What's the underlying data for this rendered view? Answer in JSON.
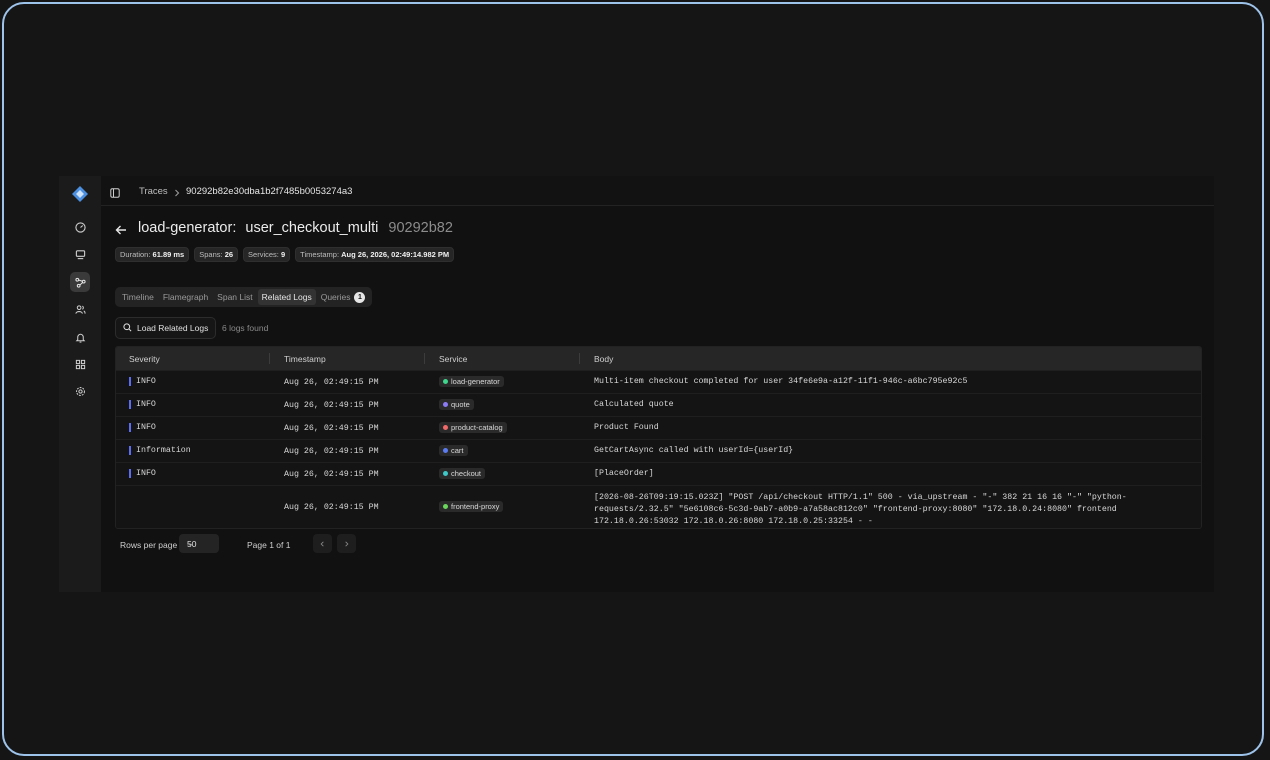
{
  "breadcrumb": {
    "section": "Traces",
    "trace_id": "90292b82e30dba1b2f7485b0053274a3"
  },
  "header": {
    "service": "load-generator:",
    "operation": "user_checkout_multi",
    "short_id": "90292b82"
  },
  "badges": [
    {
      "label": "Duration:",
      "value": "61.89 ms"
    },
    {
      "label": "Spans:",
      "value": "26"
    },
    {
      "label": "Services:",
      "value": "9"
    },
    {
      "label": "Timestamp:",
      "value": "Aug 26, 2026, 02:49:14.982 PM"
    }
  ],
  "tabs": [
    {
      "label": "Timeline",
      "active": false
    },
    {
      "label": "Flamegraph",
      "active": false
    },
    {
      "label": "Span List",
      "active": false
    },
    {
      "label": "Related Logs",
      "active": true
    },
    {
      "label": "Queries",
      "active": false,
      "count": "1"
    }
  ],
  "actions": {
    "load_label": "Load Related Logs",
    "log_count": "6 logs found"
  },
  "table": {
    "columns": [
      "Severity",
      "Timestamp",
      "Service",
      "Body"
    ],
    "rows": [
      {
        "severity": "INFO",
        "timestamp": "Aug 26, 02:49:15 PM",
        "service": "load-generator",
        "service_color": "#3dd68c",
        "body": "Multi-item checkout completed for user 34fe6e9a-a12f-11f1-946c-a6bc795e92c5"
      },
      {
        "severity": "INFO",
        "timestamp": "Aug 26, 02:49:15 PM",
        "service": "quote",
        "service_color": "#8b7cf6",
        "body": "Calculated quote"
      },
      {
        "severity": "INFO",
        "timestamp": "Aug 26, 02:49:15 PM",
        "service": "product-catalog",
        "service_color": "#f06a6a",
        "body": "Product Found"
      },
      {
        "severity": "Information",
        "timestamp": "Aug 26, 02:49:15 PM",
        "service": "cart",
        "service_color": "#5b7cf0",
        "body": "GetCartAsync called with userId={userId}"
      },
      {
        "severity": "INFO",
        "timestamp": "Aug 26, 02:49:15 PM",
        "service": "checkout",
        "service_color": "#3ec8c8",
        "body": "[PlaceOrder]"
      },
      {
        "severity": "",
        "timestamp": "Aug 26, 02:49:15 PM",
        "service": "frontend-proxy",
        "service_color": "#6ad65c",
        "body": "[2026-08-26T09:19:15.023Z] \"POST /api/checkout HTTP/1.1\" 500 - via_upstream - \"-\" 382 21 16 16 \"-\" \"python-requests/2.32.5\" \"5e6108c6-5c3d-9ab7-a0b9-a7a58ac812c0\" \"frontend-proxy:8080\" \"172.18.0.24:8080\" frontend 172.18.0.26:53032 172.18.0.26:8080 172.18.0.25:33254 - -"
      }
    ]
  },
  "pagination": {
    "rows_label": "Rows per page",
    "rows_value": "50",
    "page_label": "Page 1 of 1"
  },
  "colors": {
    "accent": "#4a8fe0",
    "severity_bar": "#5c6df0",
    "frame": "#9ec3ea"
  }
}
